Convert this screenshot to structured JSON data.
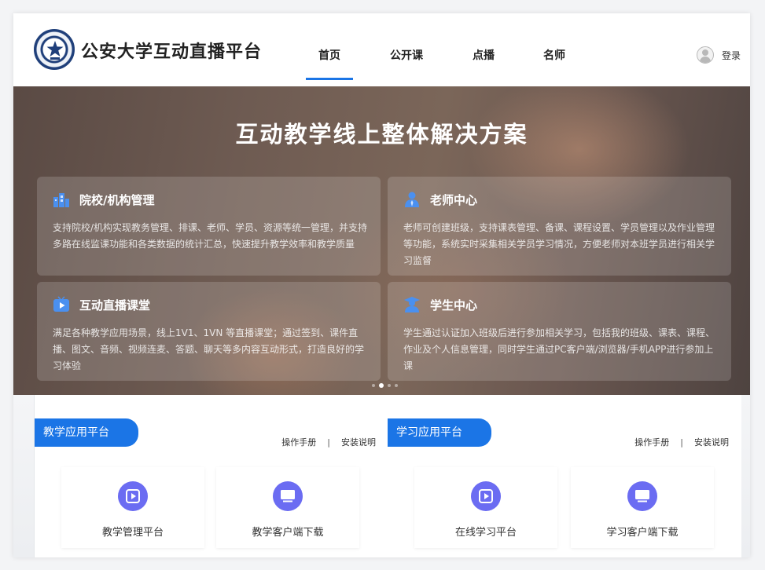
{
  "site": {
    "title": "公安大学互动直播平台",
    "logo_icon": "police-university-emblem-icon"
  },
  "nav": {
    "items": [
      {
        "label": "首页",
        "active": true
      },
      {
        "label": "公开课",
        "active": false
      },
      {
        "label": "点播",
        "active": false
      },
      {
        "label": "名师",
        "active": false
      }
    ]
  },
  "user": {
    "login_label": "登录",
    "icon": "user-avatar-icon"
  },
  "banner": {
    "title": "互动教学线上整体解决方案",
    "cards": [
      {
        "icon": "institution-building-icon",
        "title": "院校/机构管理",
        "desc": "支持院校/机构实现教务管理、排课、老师、学员、资源等统一管理，并支持多路在线监课功能和各类数据的统计汇总，快速提升教学效率和教学质量"
      },
      {
        "icon": "teacher-icon",
        "title": "老师中心",
        "desc": "老师可创建班级，支持课表管理、备课、课程设置、学员管理以及作业管理等功能，系统实时采集相关学员学习情况，方便老师对本班学员进行相关学习监督"
      },
      {
        "icon": "live-tv-icon",
        "title": "互动直播课堂",
        "desc": "满足各种教学应用场景，线上1V1、1VN 等直播课堂；通过签到、课件直播、图文、音频、视频连麦、答题、聊天等多内容互动形式，打造良好的学习体验"
      },
      {
        "icon": "student-icon",
        "title": "学生中心",
        "desc": "学生通过认证加入班级后进行参加相关学习，包括我的班级、课表、课程、作业及个人信息管理，同时学生通过PC客户端/浏览器/手机APP进行参加上课"
      }
    ],
    "carousel": {
      "count": 4,
      "active_index": 1
    }
  },
  "panels": [
    {
      "tag": "教学应用平台",
      "manual_label": "操作手册",
      "install_label": "安装说明",
      "tiles": [
        {
          "label": "教学管理平台",
          "icon": "play-platform-icon"
        },
        {
          "label": "教学客户端下载",
          "icon": "monitor-download-icon"
        }
      ]
    },
    {
      "tag": "学习应用平台",
      "manual_label": "操作手册",
      "install_label": "安装说明",
      "tiles": [
        {
          "label": "在线学习平台",
          "icon": "play-platform-icon"
        },
        {
          "label": "学习客户端下载",
          "icon": "monitor-download-icon"
        }
      ]
    }
  ],
  "colors": {
    "accent": "#1b75e6",
    "tile_icon_bg": "#6b6cf2",
    "card_icon": "#4a90f0"
  }
}
